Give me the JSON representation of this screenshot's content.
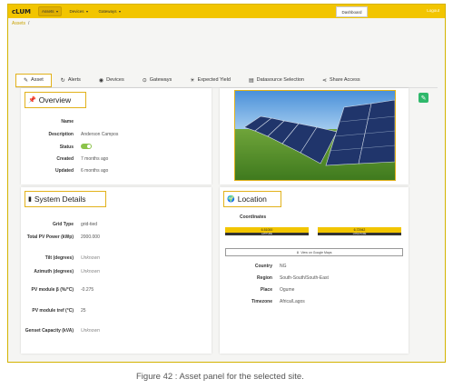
{
  "app": {
    "brand": "cLUM",
    "dashboard": "Dashboard",
    "logout": "Logout"
  },
  "nav": [
    {
      "label": "Assets"
    },
    {
      "label": "Devices"
    },
    {
      "label": "Gateways"
    }
  ],
  "breadcrumb": {
    "root": "Assets",
    "sep": "/"
  },
  "tabs": [
    {
      "label": "Asset",
      "icon": "puzzle-icon"
    },
    {
      "label": "Alerts",
      "icon": "refresh-icon"
    },
    {
      "label": "Devices",
      "icon": "device-icon"
    },
    {
      "label": "Gateways",
      "icon": "gateway-icon"
    },
    {
      "label": "Expected Yield",
      "icon": "sun-icon"
    },
    {
      "label": "Datasource Selection",
      "icon": "database-icon"
    },
    {
      "label": "Share Access",
      "icon": "share-icon"
    }
  ],
  "overview": {
    "title": "Overview",
    "name_label": "Name",
    "name_value": "",
    "description_label": "Description",
    "description_value": "Anderson Campos",
    "status_label": "Status",
    "created_label": "Created",
    "created_value": "7 months ago",
    "updated_label": "Updated",
    "updated_value": "6 months ago"
  },
  "system": {
    "title": "System Details",
    "rows": [
      {
        "label": "Grid Type",
        "value": "grid-tied"
      },
      {
        "label": "Total PV Power (kWp)",
        "value": "2000.000"
      },
      {
        "label": "Tilt (degrees)",
        "value": "Unknown"
      },
      {
        "label": "Azimuth (degrees)",
        "value": "Unknown"
      },
      {
        "label": "PV module β (%/°C)",
        "value": "-0.275"
      },
      {
        "label": "PV module tref (°C)",
        "value": "25"
      },
      {
        "label": "Genset Capacity (kVA)",
        "value": "Unknown"
      }
    ]
  },
  "location": {
    "title": "Location",
    "coordinates_label": "Coordinates",
    "lat_value": "6.51000",
    "lat_label": "LATITUDE",
    "lng_value": "6.72942",
    "lng_label": "LONGITUDE",
    "maps_btn": "View on Google Maps",
    "country_label": "Country",
    "country_value": "NG",
    "region_label": "Region",
    "region_value": "South-South/South-East",
    "place_label": "Place",
    "place_value": "Ogume",
    "timezone_label": "Timezone",
    "timezone_value": "Africa/Lagos"
  },
  "caption": "Figure 42 : Asset panel for the selected site.",
  "colors": {
    "accent": "#f2c500",
    "toggle": "#8bc34a",
    "edit": "#2fb86b"
  }
}
